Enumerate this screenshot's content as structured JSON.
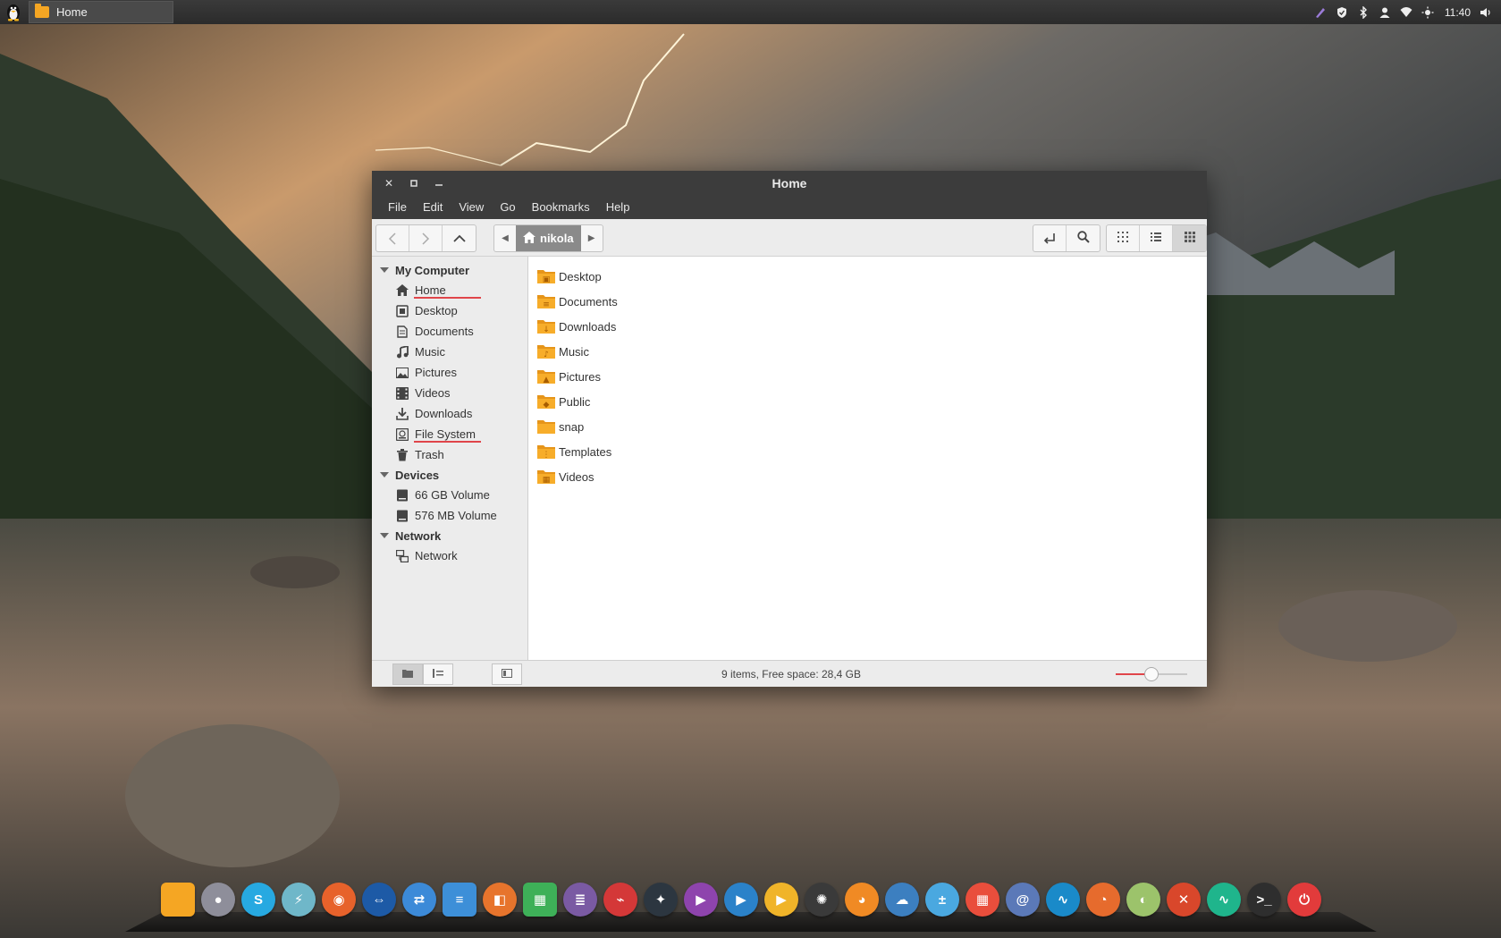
{
  "top_panel": {
    "taskbar_item": "Home",
    "clock": "11:40",
    "tray_icons": [
      "pen-icon",
      "shield-icon",
      "bluetooth-icon",
      "user-icon",
      "wifi-icon",
      "brightness-icon",
      "volume-icon"
    ]
  },
  "window": {
    "title": "Home",
    "menu": [
      "File",
      "Edit",
      "View",
      "Go",
      "Bookmarks",
      "Help"
    ],
    "path": {
      "current": "nikola"
    },
    "sidebar": {
      "sections": [
        {
          "label": "My Computer",
          "items": [
            {
              "label": "Home",
              "icon": "home-icon"
            },
            {
              "label": "Desktop",
              "icon": "desktop-icon"
            },
            {
              "label": "Documents",
              "icon": "document-icon"
            },
            {
              "label": "Music",
              "icon": "music-icon"
            },
            {
              "label": "Pictures",
              "icon": "picture-icon"
            },
            {
              "label": "Videos",
              "icon": "video-icon"
            },
            {
              "label": "Downloads",
              "icon": "download-icon"
            },
            {
              "label": "File System",
              "icon": "filesystem-icon"
            },
            {
              "label": "Trash",
              "icon": "trash-icon"
            }
          ]
        },
        {
          "label": "Devices",
          "items": [
            {
              "label": "66 GB Volume",
              "icon": "drive-icon"
            },
            {
              "label": "576 MB Volume",
              "icon": "drive-icon"
            }
          ]
        },
        {
          "label": "Network",
          "items": [
            {
              "label": "Network",
              "icon": "network-icon"
            }
          ]
        }
      ]
    },
    "files": [
      {
        "name": "Desktop",
        "icon": "folder-desktop-icon"
      },
      {
        "name": "Documents",
        "icon": "folder-documents-icon"
      },
      {
        "name": "Downloads",
        "icon": "folder-downloads-icon"
      },
      {
        "name": "Music",
        "icon": "folder-music-icon"
      },
      {
        "name": "Pictures",
        "icon": "folder-pictures-icon"
      },
      {
        "name": "Public",
        "icon": "folder-public-icon"
      },
      {
        "name": "snap",
        "icon": "folder-icon"
      },
      {
        "name": "Templates",
        "icon": "folder-templates-icon"
      },
      {
        "name": "Videos",
        "icon": "folder-videos-icon"
      }
    ],
    "status": "9 items, Free space: 28,4 GB",
    "zoom_level": 0.5
  },
  "dock": {
    "apps": [
      {
        "name": "files-icon",
        "color": "#f5a623"
      },
      {
        "name": "pidgin-icon",
        "color": "#8e8e9a"
      },
      {
        "name": "skype-icon",
        "color": "#27a9e1"
      },
      {
        "name": "messenger-icon",
        "color": "#6fb7c9"
      },
      {
        "name": "firefox-icon",
        "color": "#e7622b"
      },
      {
        "name": "teamviewer-icon",
        "color": "#1d5aa6"
      },
      {
        "name": "remote-icon",
        "color": "#3c8ad8"
      },
      {
        "name": "writer-icon",
        "color": "#3d8fd8"
      },
      {
        "name": "impress-icon",
        "color": "#e7742c"
      },
      {
        "name": "calc-icon",
        "color": "#3eb058"
      },
      {
        "name": "text-editor-icon",
        "color": "#7a5aa3"
      },
      {
        "name": "pdf-icon",
        "color": "#d43838"
      },
      {
        "name": "kodi-icon",
        "color": "#2c3640"
      },
      {
        "name": "video-player-icon",
        "color": "#8e44ad"
      },
      {
        "name": "media-player-icon",
        "color": "#2b82c9"
      },
      {
        "name": "play-icon",
        "color": "#f0b429"
      },
      {
        "name": "inkscape-icon",
        "color": "#3a3a3a"
      },
      {
        "name": "gimp-icon",
        "color": "#f08a24"
      },
      {
        "name": "cloud-icon",
        "color": "#3c7fc0"
      },
      {
        "name": "calculator-icon",
        "color": "#4aa8e0"
      },
      {
        "name": "app-grid-icon",
        "color": "#e94e3c"
      },
      {
        "name": "swirl-icon",
        "color": "#5b79b8"
      },
      {
        "name": "monitor-icon",
        "color": "#1a8ac9"
      },
      {
        "name": "disk-icon",
        "color": "#e66b2d"
      },
      {
        "name": "toggle-icon",
        "color": "#9cc36b"
      },
      {
        "name": "tools-icon",
        "color": "#d9472b"
      },
      {
        "name": "activity-icon",
        "color": "#1fb58c"
      },
      {
        "name": "terminal-icon",
        "color": "#2e2e2e"
      },
      {
        "name": "power-icon",
        "color": "#e23b3b"
      }
    ]
  }
}
